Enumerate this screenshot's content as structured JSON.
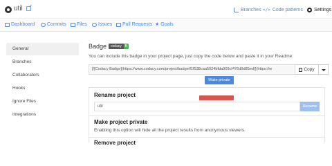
{
  "repo": {
    "name": "util"
  },
  "top_nav": {
    "branches": "Branches",
    "code_patterns": "Code patterns",
    "settings": "Settings"
  },
  "nav": {
    "dashboard": "Dashboard",
    "commits": "Commits",
    "files": "Files",
    "issues": "Issues",
    "pull_requests": "Pull Requests",
    "goals": "Goals"
  },
  "sidebar": {
    "items": [
      {
        "label": "General",
        "active": true
      },
      {
        "label": "Branches"
      },
      {
        "label": "Collaborators"
      },
      {
        "label": "Hooks"
      },
      {
        "label": "Ignore Files"
      },
      {
        "label": "Integrations"
      }
    ]
  },
  "badge": {
    "title": "Badge",
    "badge_label": "codacy",
    "badge_grade": "B",
    "description": "You can include this badge in your project page, just copy the code below and paste it in your Readme:",
    "code": "[![Codacy Badge](https://www.codacy.com/project/badge/f1f538caa5024bfda909cf476d9d85ed)](https://w",
    "copy_label": "Copy"
  },
  "rename": {
    "title": "Rename project",
    "value": "util",
    "button": "Rename"
  },
  "make_private": {
    "title": "Make project private",
    "description": "Enabling this option will hide all the project results from anonymous viewers.",
    "button": "Make private"
  },
  "remove": {
    "title": "Remove project"
  },
  "colors": {
    "accent": "#4a89dc",
    "danger": "#d9534f",
    "badge_grade": "#4caf50"
  }
}
